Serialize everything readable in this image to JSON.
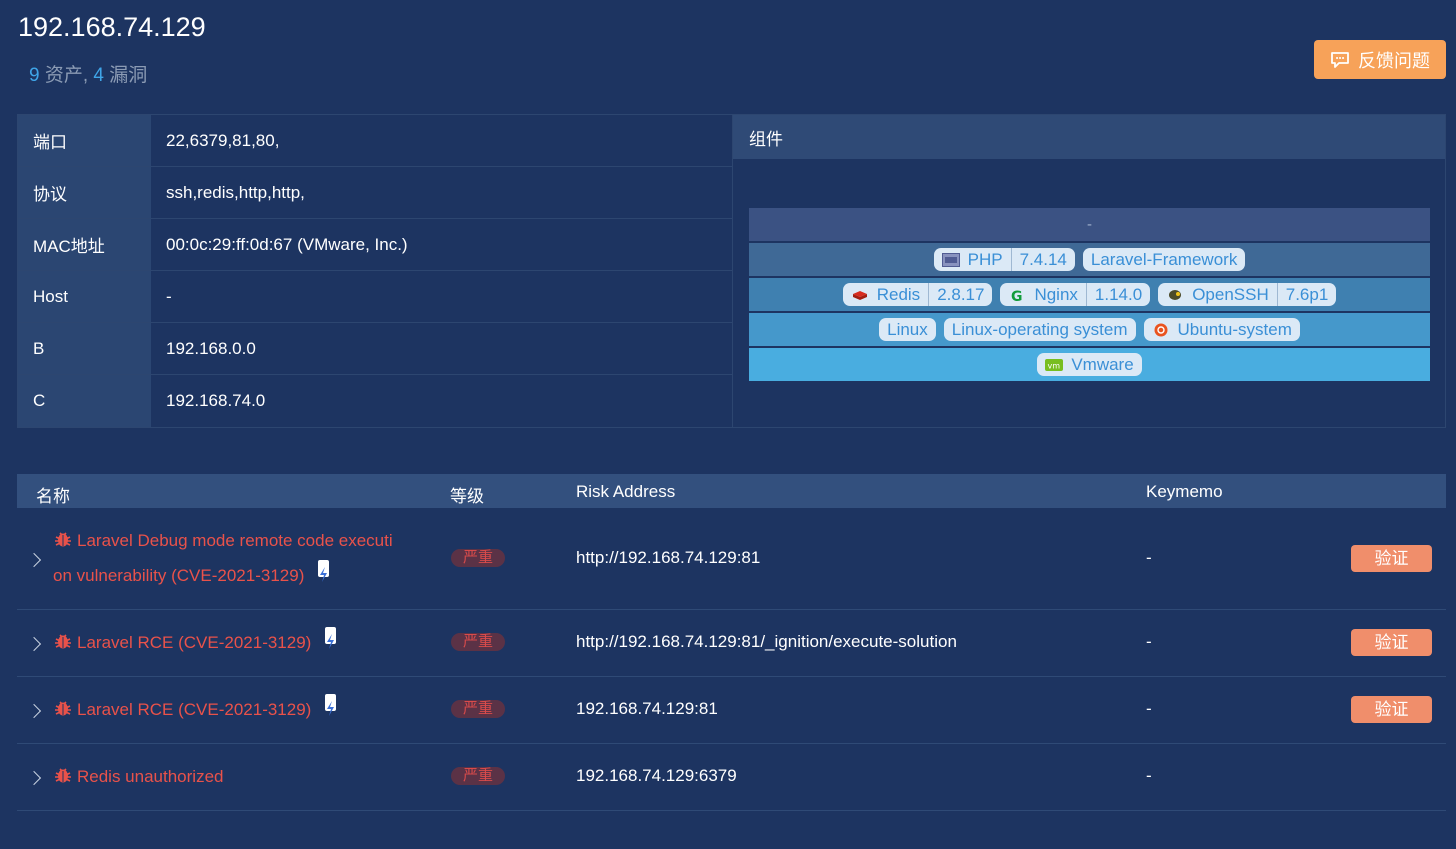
{
  "header": {
    "ip": "192.168.74.129",
    "asset_count": "9",
    "asset_label": "资产,",
    "vuln_count": "4",
    "vuln_label": "漏洞",
    "feedback_label": "反馈问题"
  },
  "info": {
    "rows": [
      {
        "key": "端口",
        "value": "22,6379,81,80,"
      },
      {
        "key": "协议",
        "value": "ssh,redis,http,http,"
      },
      {
        "key": "MAC地址",
        "value": "00:0c:29:ff:0d:67 (VMware, Inc.)"
      },
      {
        "key": "Host",
        "value": "-"
      },
      {
        "key": "B",
        "value": "192.168.0.0"
      },
      {
        "key": "C",
        "value": "192.168.74.0"
      }
    ]
  },
  "components": {
    "title": "组件",
    "layer0": "-",
    "php_name": "PHP",
    "php_version": "7.4.14",
    "laravel": "Laravel-Framework",
    "redis_name": "Redis",
    "redis_version": "2.8.17",
    "nginx_name": "Nginx",
    "nginx_version": "1.14.0",
    "openssh_name": "OpenSSH",
    "openssh_version": "7.6p1",
    "linux": "Linux",
    "linux_os": "Linux-operating system",
    "ubuntu": "Ubuntu-system",
    "vmware": "Vmware",
    "icons": [
      "php-icon",
      "redis-icon",
      "nginx-icon",
      "openssh-icon",
      "ubuntu-icon",
      "vmware-icon"
    ]
  },
  "vulns": {
    "headers": {
      "name": "名称",
      "level": "等级",
      "address": "Risk Address",
      "memo": "Keymemo"
    },
    "rows": [
      {
        "name": "Laravel Debug mode remote code execution vulnerability (CVE-2021-3129)",
        "name_line1": "Laravel Debug mode remote code executi",
        "name_line2": "on vulnerability (CVE-2021-3129)",
        "level": "严重",
        "address": "http://192.168.74.129:81",
        "memo": "-",
        "verify": "验证"
      },
      {
        "name": "Laravel RCE (CVE-2021-3129)",
        "level": "严重",
        "address": "http://192.168.74.129:81/_ignition/execute-solution",
        "memo": "-",
        "verify": "验证"
      },
      {
        "name": "Laravel RCE (CVE-2021-3129)",
        "level": "严重",
        "address": "192.168.74.129:81",
        "memo": "-",
        "verify": "验证"
      },
      {
        "name": "Redis unauthorized",
        "level": "严重",
        "address": "192.168.74.129:6379",
        "memo": "-"
      }
    ]
  },
  "colors": {
    "background": "#1d3461",
    "accent": "#3fa5e8",
    "feedback": "#f7a259",
    "danger": "#e9524a",
    "verify": "#f08e6b"
  }
}
